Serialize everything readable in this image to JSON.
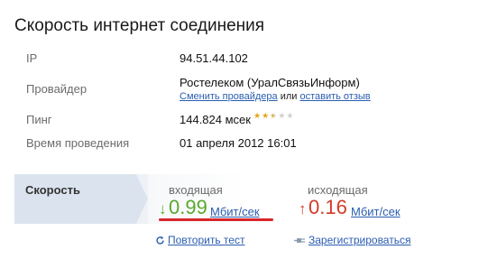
{
  "title": "Скорость интернет соединения",
  "rows": {
    "ip": {
      "label": "IP",
      "value": "94.51.44.102"
    },
    "provider": {
      "label": "Провайдер",
      "value": "Ростелеком (УралСвязьИнформ)",
      "change_link": "Сменить провайдера",
      "or_text": "или",
      "review_link": "оставить отзыв"
    },
    "ping": {
      "label": "Пинг",
      "value": "144.824 мсек",
      "rating": 2.5,
      "rating_max": 5
    },
    "time": {
      "label": "Время проведения",
      "value": "01 апреля 2012 16:01"
    }
  },
  "speed": {
    "label": "Скорость",
    "incoming": {
      "label": "входящая",
      "arrow": "↓",
      "value": "0.99",
      "unit": "Мбит/сек",
      "color": "#5aa82c"
    },
    "outgoing": {
      "label": "исходящая",
      "arrow": "↑",
      "value": "0.16",
      "unit": "Мбит/сек",
      "color": "#d23a2a"
    }
  },
  "actions": {
    "repeat": {
      "label": "Повторить тест",
      "icon": "refresh-icon"
    },
    "register": {
      "label": "Зарегистрироваться",
      "icon": "plug-icon"
    }
  }
}
